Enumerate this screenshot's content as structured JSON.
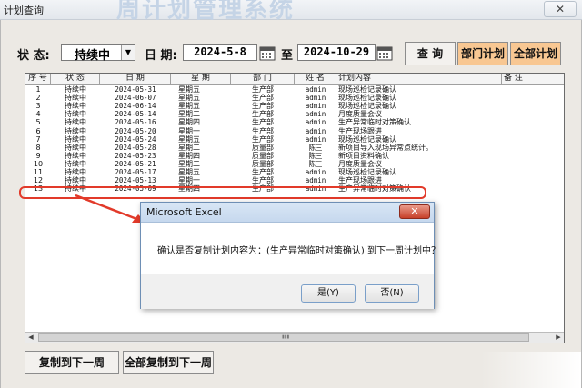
{
  "window": {
    "title": "计划查询",
    "watermark": "周计划管理系统",
    "close_glyph": "✕"
  },
  "filters": {
    "status_label": "状 态:",
    "status_value": "持续中",
    "date_label": "日 期:",
    "date_from": "2024-5-8",
    "to_label": "至",
    "date_to": "2024-10-29"
  },
  "buttons": {
    "query": "查 询",
    "dept_plan": "部门计划",
    "all_plan": "全部计划"
  },
  "grid": {
    "columns": [
      "序 号",
      "状 态",
      "日 期",
      "星 期",
      "部 门",
      "姓 名",
      "计划内容",
      "备 注"
    ],
    "rows": [
      [
        "1",
        "持续中",
        "2024-05-31",
        "星期五",
        "生产部",
        "admin",
        "现场巡检记录确认",
        ""
      ],
      [
        "2",
        "持续中",
        "2024-06-07",
        "星期五",
        "生产部",
        "admin",
        "现场巡检记录确认",
        ""
      ],
      [
        "3",
        "持续中",
        "2024-06-14",
        "星期五",
        "生产部",
        "admin",
        "现场巡检记录确认",
        ""
      ],
      [
        "4",
        "持续中",
        "2024-05-14",
        "星期二",
        "生产部",
        "admin",
        "月度质量会议",
        ""
      ],
      [
        "5",
        "持续中",
        "2024-05-16",
        "星期四",
        "生产部",
        "admin",
        "生产异常临时对策确认",
        ""
      ],
      [
        "6",
        "持续中",
        "2024-05-20",
        "星期一",
        "生产部",
        "admin",
        "生产现场跟进",
        ""
      ],
      [
        "7",
        "持续中",
        "2024-05-24",
        "星期五",
        "生产部",
        "admin",
        "现场巡检记录确认",
        ""
      ],
      [
        "8",
        "持续中",
        "2024-05-28",
        "星期二",
        "质量部",
        "陈三",
        "新项目导入现场异常点统计。",
        ""
      ],
      [
        "9",
        "持续中",
        "2024-05-23",
        "星期四",
        "质量部",
        "陈三",
        "新项目资料确认",
        ""
      ],
      [
        "10",
        "持续中",
        "2024-05-21",
        "星期二",
        "质量部",
        "陈三",
        "月度质量会议",
        ""
      ],
      [
        "11",
        "持续中",
        "2024-05-17",
        "星期五",
        "生产部",
        "admin",
        "现场巡检记录确认",
        ""
      ],
      [
        "12",
        "持续中",
        "2024-05-13",
        "星期一",
        "生产部",
        "admin",
        "生产现场跟进",
        ""
      ],
      [
        "13",
        "持续中",
        "2024-05-09",
        "星期四",
        "生产部",
        "admin",
        "生产异常临时对策确认",
        ""
      ]
    ]
  },
  "dialog": {
    "title": "Microsoft Excel",
    "close_glyph": "✕",
    "message": "确认是否复制计划内容为：(生产异常临时对策确认) 到下一周计划中？",
    "yes": "是(Y)",
    "no": "否(N)"
  },
  "bottom": {
    "copy_next_week": "复制到下一周",
    "copy_all_next_week": "全部复制到下一周"
  },
  "colors": {
    "highlight": "#e23a2a",
    "orange_button": "#f8c792"
  }
}
